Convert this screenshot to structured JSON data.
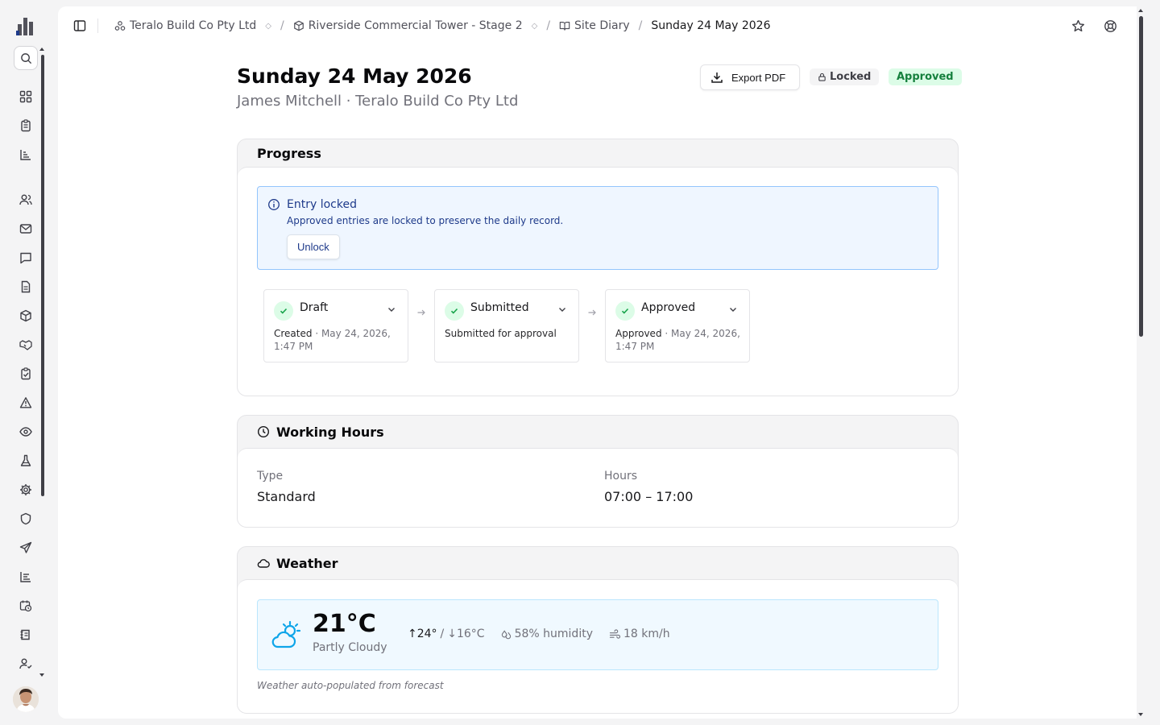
{
  "breadcrumb": {
    "company": "Teralo Build Co Pty Ltd",
    "project": "Riverside Commercial Tower - Stage 2",
    "section": "Site Diary",
    "current": "Sunday 24 May 2026",
    "separator": "/"
  },
  "header": {
    "title": "Sunday 24 May 2026",
    "subtitle": "James Mitchell · Teralo Build Co Pty Ltd",
    "export_label": "Export PDF",
    "locked_badge": "Locked",
    "status_badge": "Approved"
  },
  "progress": {
    "title": "Progress",
    "alert": {
      "title": "Entry locked",
      "description": "Approved entries are locked to preserve the daily record.",
      "button": "Unlock"
    },
    "steps": [
      {
        "label": "Draft",
        "meta_label": "Created",
        "meta_date": "· May 24, 2026, 1:47 PM"
      },
      {
        "label": "Submitted",
        "meta_label": "Submitted for approval",
        "meta_date": ""
      },
      {
        "label": "Approved",
        "meta_label": "Approved",
        "meta_date": "· May 24, 2026, 1:47 PM"
      }
    ]
  },
  "working_hours": {
    "title": "Working Hours",
    "type_label": "Type",
    "type_value": "Standard",
    "hours_label": "Hours",
    "hours_value": "07:00 – 17:00"
  },
  "weather": {
    "title": "Weather",
    "temperature": "21°C",
    "condition": "Partly Cloudy",
    "high": "↑24°",
    "low_sep": "/",
    "low": "↓16°C",
    "humidity": "58% humidity",
    "wind": "18 km/h",
    "note": "Weather auto-populated from forecast"
  },
  "colors": {
    "accent_blue": "#1e3a8a",
    "success_green": "#15803d",
    "success_bg": "#dcfce7"
  }
}
